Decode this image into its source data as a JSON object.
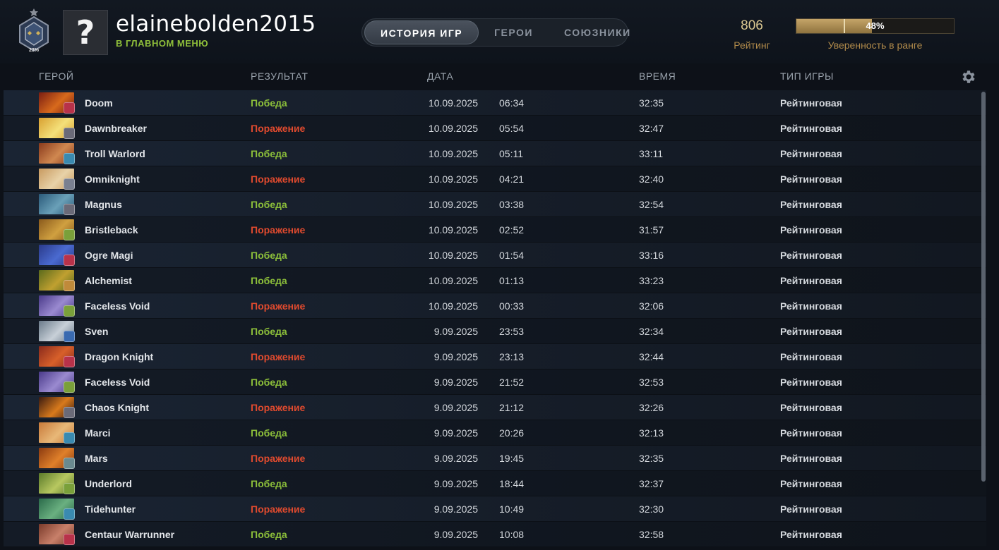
{
  "header": {
    "rank_percent": "23%",
    "avatar_glyph": "?",
    "username": "elainebolden2015",
    "status": "В ГЛАВНОМ МЕНЮ",
    "tabs": [
      {
        "label": "ИСТОРИЯ ИГР",
        "active": true
      },
      {
        "label": "ГЕРОИ",
        "active": false
      },
      {
        "label": "СОЮЗНИКИ",
        "active": false
      }
    ],
    "rating_value": "806",
    "rating_label": "Рейтинг",
    "confidence_value": "48%",
    "confidence_fraction": 0.48,
    "confidence_label": "Уверенность в ранге"
  },
  "table": {
    "columns": {
      "hero": "ГЕРОЙ",
      "result": "РЕЗУЛЬТАТ",
      "date": "ДАТА",
      "duration": "ВРЕМЯ",
      "mode": "ТИП ИГРЫ"
    },
    "settings_icon": "gear-icon",
    "rows": [
      {
        "hero": "Doom",
        "result": "Победа",
        "win": true,
        "date": "10.09.2025",
        "time": "06:34",
        "duration": "32:35",
        "mode": "Рейтинговая",
        "c1": "#7a1d12",
        "c2": "#d86a1c",
        "badge": "#b8324a"
      },
      {
        "hero": "Dawnbreaker",
        "result": "Поражение",
        "win": false,
        "date": "10.09.2025",
        "time": "05:54",
        "duration": "32:47",
        "mode": "Рейтинговая",
        "c1": "#d8a030",
        "c2": "#f4e07a",
        "badge": "#6a6a78"
      },
      {
        "hero": "Troll Warlord",
        "result": "Победа",
        "win": true,
        "date": "10.09.2025",
        "time": "05:11",
        "duration": "33:11",
        "mode": "Рейтинговая",
        "c1": "#8a3a1c",
        "c2": "#d08850",
        "badge": "#3a8ab0"
      },
      {
        "hero": "Omniknight",
        "result": "Поражение",
        "win": false,
        "date": "10.09.2025",
        "time": "04:21",
        "duration": "32:40",
        "mode": "Рейтинговая",
        "c1": "#c89a60",
        "c2": "#e8d2a8",
        "badge": "#7a8090"
      },
      {
        "hero": "Magnus",
        "result": "Победа",
        "win": true,
        "date": "10.09.2025",
        "time": "03:38",
        "duration": "32:54",
        "mode": "Рейтинговая",
        "c1": "#2a5a7a",
        "c2": "#6aa0b8",
        "badge": "#6a6a78"
      },
      {
        "hero": "Bristleback",
        "result": "Поражение",
        "win": false,
        "date": "10.09.2025",
        "time": "02:52",
        "duration": "31:57",
        "mode": "Рейтинговая",
        "c1": "#8a5a1c",
        "c2": "#d0a040",
        "badge": "#7aa03a"
      },
      {
        "hero": "Ogre Magi",
        "result": "Победа",
        "win": true,
        "date": "10.09.2025",
        "time": "01:54",
        "duration": "33:16",
        "mode": "Рейтинговая",
        "c1": "#2a3a8a",
        "c2": "#4a6ad0",
        "badge": "#b8324a"
      },
      {
        "hero": "Alchemist",
        "result": "Победа",
        "win": true,
        "date": "10.09.2025",
        "time": "01:13",
        "duration": "33:23",
        "mode": "Рейтинговая",
        "c1": "#5a6a1c",
        "c2": "#c0a030",
        "badge": "#c08a3a"
      },
      {
        "hero": "Faceless Void",
        "result": "Поражение",
        "win": false,
        "date": "10.09.2025",
        "time": "00:33",
        "duration": "32:06",
        "mode": "Рейтинговая",
        "c1": "#4a3a8a",
        "c2": "#9a8ad0",
        "badge": "#7aa03a"
      },
      {
        "hero": "Sven",
        "result": "Победа",
        "win": true,
        "date": "9.09.2025",
        "time": "23:53",
        "duration": "32:34",
        "mode": "Рейтинговая",
        "c1": "#6a7a8a",
        "c2": "#c8d0d8",
        "badge": "#3a6ab0"
      },
      {
        "hero": "Dragon Knight",
        "result": "Поражение",
        "win": false,
        "date": "9.09.2025",
        "time": "23:13",
        "duration": "32:44",
        "mode": "Рейтинговая",
        "c1": "#8a2a1c",
        "c2": "#d8602a",
        "badge": "#b8324a"
      },
      {
        "hero": "Faceless Void",
        "result": "Победа",
        "win": true,
        "date": "9.09.2025",
        "time": "21:52",
        "duration": "32:53",
        "mode": "Рейтинговая",
        "c1": "#4a3a8a",
        "c2": "#9a8ad0",
        "badge": "#7aa03a"
      },
      {
        "hero": "Chaos Knight",
        "result": "Поражение",
        "win": false,
        "date": "9.09.2025",
        "time": "21:12",
        "duration": "32:26",
        "mode": "Рейтинговая",
        "c1": "#3a1a10",
        "c2": "#d87a1c",
        "badge": "#6a6a78"
      },
      {
        "hero": "Marci",
        "result": "Победа",
        "win": true,
        "date": "9.09.2025",
        "time": "20:26",
        "duration": "32:13",
        "mode": "Рейтинговая",
        "c1": "#c87a3a",
        "c2": "#e8b878",
        "badge": "#3a8ab0"
      },
      {
        "hero": "Mars",
        "result": "Поражение",
        "win": false,
        "date": "9.09.2025",
        "time": "19:45",
        "duration": "32:35",
        "mode": "Рейтинговая",
        "c1": "#8a3a10",
        "c2": "#e0802a",
        "badge": "#6a8a90"
      },
      {
        "hero": "Underlord",
        "result": "Победа",
        "win": true,
        "date": "9.09.2025",
        "time": "18:44",
        "duration": "32:37",
        "mode": "Рейтинговая",
        "c1": "#5a7a2a",
        "c2": "#b8c860",
        "badge": "#7aa03a"
      },
      {
        "hero": "Tidehunter",
        "result": "Поражение",
        "win": false,
        "date": "9.09.2025",
        "time": "10:49",
        "duration": "32:30",
        "mode": "Рейтинговая",
        "c1": "#2a6a4a",
        "c2": "#6ab080",
        "badge": "#3a8ab0"
      },
      {
        "hero": "Centaur Warrunner",
        "result": "Победа",
        "win": true,
        "date": "9.09.2025",
        "time": "10:08",
        "duration": "32:58",
        "mode": "Рейтинговая",
        "c1": "#7a3a2a",
        "c2": "#c8806a",
        "badge": "#b8324a"
      }
    ]
  }
}
